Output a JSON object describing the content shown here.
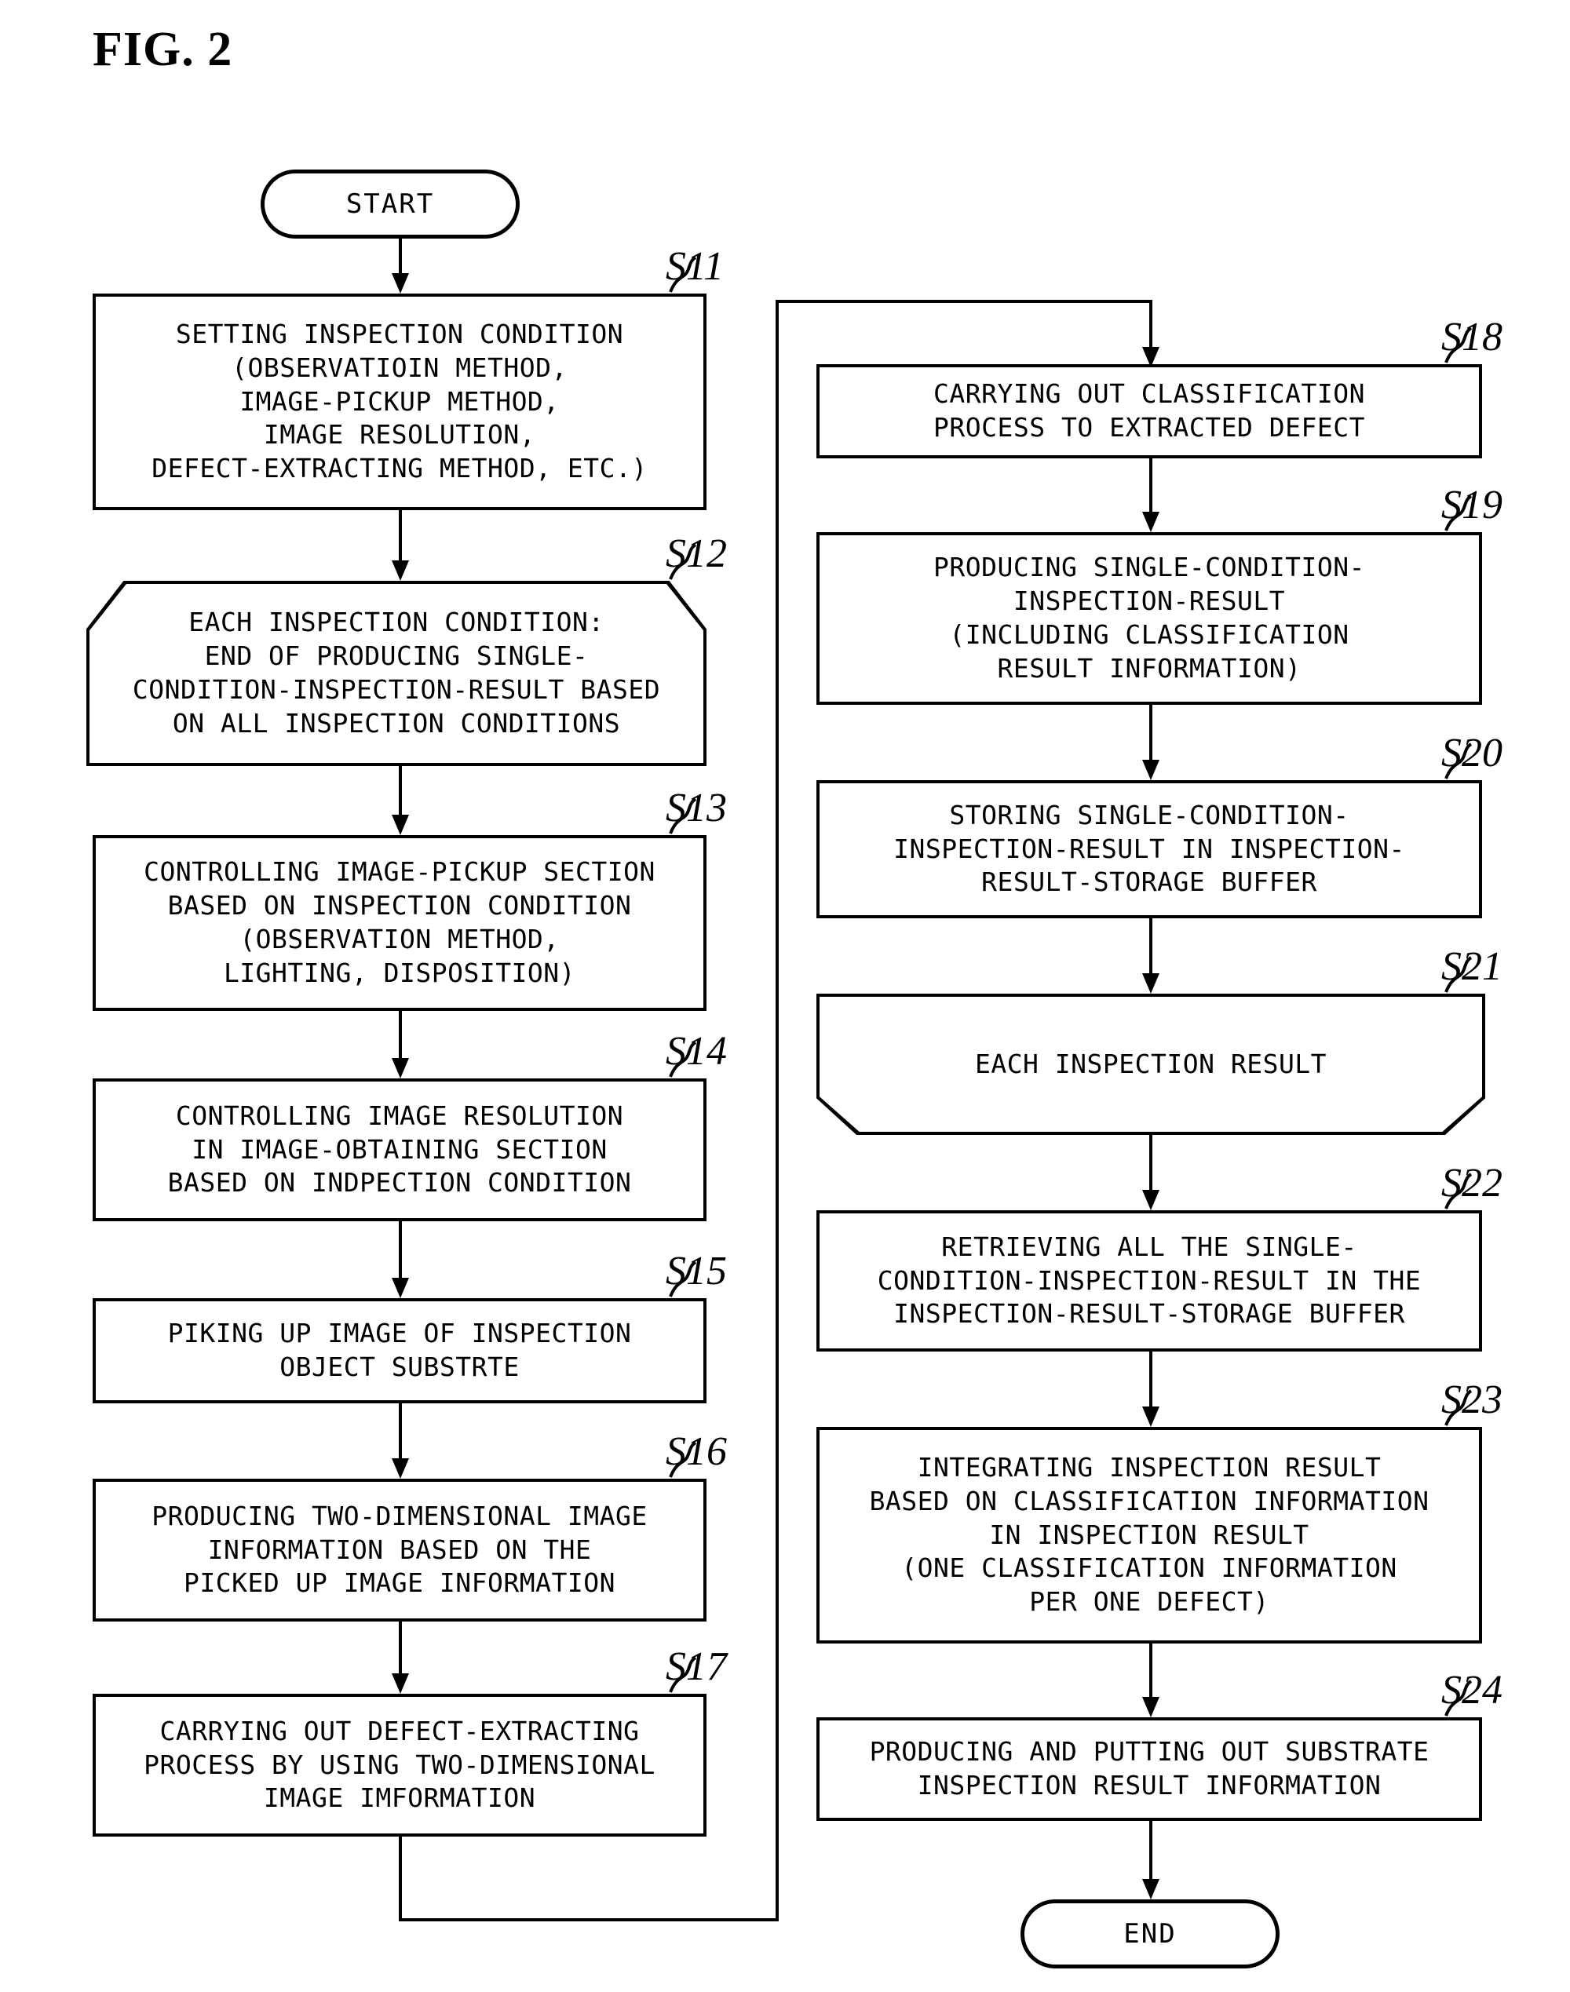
{
  "figure": {
    "title": "FIG. 2",
    "type": "flowchart",
    "start_label": "START",
    "end_label": "END"
  },
  "steps": [
    {
      "id": "S11",
      "label": "S11",
      "shape": "process",
      "text": "SETTING INSPECTION CONDITION\n(OBSERVATIOIN METHOD,\nIMAGE-PICKUP METHOD,\nIMAGE RESOLUTION,\nDEFECT-EXTRACTING METHOD, ETC.)"
    },
    {
      "id": "S12",
      "label": "S12",
      "shape": "loop-start",
      "text": "EACH INSPECTION CONDITION:\nEND OF PRODUCING SINGLE-\nCONDITION-INSPECTION-RESULT BASED\nON ALL INSPECTION CONDITIONS"
    },
    {
      "id": "S13",
      "label": "S13",
      "shape": "process",
      "text": "CONTROLLING IMAGE-PICKUP SECTION\nBASED ON INSPECTION CONDITION\n(OBSERVATION METHOD,\nLIGHTING, DISPOSITION)"
    },
    {
      "id": "S14",
      "label": "S14",
      "shape": "process",
      "text": "CONTROLLING IMAGE RESOLUTION\nIN IMAGE-OBTAINING SECTION\nBASED ON INDPECTION CONDITION"
    },
    {
      "id": "S15",
      "label": "S15",
      "shape": "process",
      "text": "PIKING UP IMAGE OF INSPECTION\nOBJECT SUBSTRTE"
    },
    {
      "id": "S16",
      "label": "S16",
      "shape": "process",
      "text": "PRODUCING TWO-DIMENSIONAL IMAGE\nINFORMATION BASED ON THE\nPICKED UP IMAGE INFORMATION"
    },
    {
      "id": "S17",
      "label": "S17",
      "shape": "process",
      "text": "CARRYING OUT DEFECT-EXTRACTING\nPROCESS BY USING TWO-DIMENSIONAL\nIMAGE IMFORMATION"
    },
    {
      "id": "S18",
      "label": "S18",
      "shape": "process",
      "text": "CARRYING OUT CLASSIFICATION\nPROCESS TO EXTRACTED DEFECT"
    },
    {
      "id": "S19",
      "label": "S19",
      "shape": "process",
      "text": "PRODUCING SINGLE-CONDITION-\nINSPECTION-RESULT\n(INCLUDING CLASSIFICATION\nRESULT INFORMATION)"
    },
    {
      "id": "S20",
      "label": "S20",
      "shape": "process",
      "text": "STORING SINGLE-CONDITION-\nINSPECTION-RESULT IN INSPECTION-\nRESULT-STORAGE BUFFER"
    },
    {
      "id": "S21",
      "label": "S21",
      "shape": "loop-end",
      "text": "EACH INSPECTION RESULT"
    },
    {
      "id": "S22",
      "label": "S22",
      "shape": "process",
      "text": "RETRIEVING ALL THE SINGLE-\nCONDITION-INSPECTION-RESULT IN THE\nINSPECTION-RESULT-STORAGE BUFFER"
    },
    {
      "id": "S23",
      "label": "S23",
      "shape": "process",
      "text": "INTEGRATING INSPECTION RESULT\nBASED ON CLASSIFICATION INFORMATION\nIN INSPECTION RESULT\n(ONE CLASSIFICATION INFORMATION\nPER ONE DEFECT)"
    },
    {
      "id": "S24",
      "label": "S24",
      "shape": "process",
      "text": "PRODUCING AND PUTTING OUT SUBSTRATE\nINSPECTION RESULT INFORMATION"
    }
  ],
  "colors": {
    "stroke": "#000000",
    "background": "#ffffff",
    "text": "#000000"
  }
}
